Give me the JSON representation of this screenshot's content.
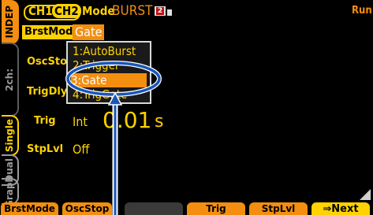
{
  "side_tabs": {
    "indep": "INDEP",
    "two_ch": "2ch:",
    "single": "Single",
    "dual": "Dual",
    "graph": "Graph"
  },
  "header": {
    "ch1": "CH1",
    "ch2": "CH2",
    "mode_label": "Mode",
    "mode_value": "BURST",
    "badge": "2",
    "status": "Run"
  },
  "fields": {
    "brst_mode": {
      "label": "BrstMode",
      "value": "Gate"
    },
    "osc_stop": {
      "label": "OscStop"
    },
    "trig_dly": {
      "label": "TrigDly"
    },
    "trig": {
      "label": "Trig",
      "value": "Int",
      "big_value": "0.01",
      "unit": "s"
    },
    "stp_lvl": {
      "label": "StpLvl",
      "value": "Off"
    }
  },
  "dropdown": {
    "items": [
      "1:AutoBurst",
      "2:Trigger",
      "3:Gate",
      "4:TrigGate"
    ],
    "selected_index": 2
  },
  "softkeys": [
    "BrstMode",
    "OscStop",
    "",
    "Trig",
    "StpLvl",
    "⇒Next"
  ],
  "colors": {
    "accent": "#ffd200",
    "orange": "#f38e10",
    "annotation": "#1a56b8"
  }
}
